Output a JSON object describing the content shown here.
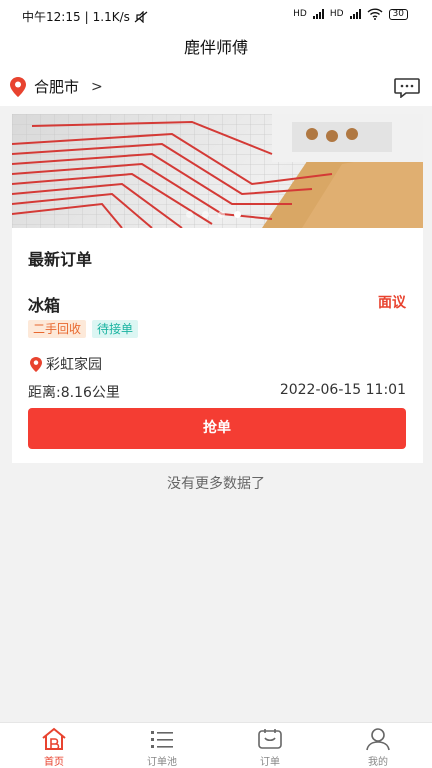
{
  "status": {
    "time": "中午12:15",
    "speed": "1.1K/s",
    "net1": "HD",
    "net2": "HD",
    "battery": "30"
  },
  "header": {
    "title": "鹿伴师傅"
  },
  "location": {
    "city": "合肥市"
  },
  "banner": {
    "total_slides": 4,
    "active_slide": 4
  },
  "latest": {
    "title": "最新订单",
    "order": {
      "name": "冰箱",
      "action": "面议",
      "tags": [
        "二手回收",
        "待接单"
      ],
      "address": "彩虹家园",
      "distance": "距离:8.16公里",
      "time": "2022-06-15 11:01",
      "button": "抢单"
    }
  },
  "no_more": "没有更多数据了",
  "tabs": [
    {
      "label": "首页",
      "icon": "home-icon",
      "active": true
    },
    {
      "label": "订单池",
      "icon": "list-icon",
      "active": false
    },
    {
      "label": "订单",
      "icon": "order-icon",
      "active": false
    },
    {
      "label": "我的",
      "icon": "user-icon",
      "active": false
    }
  ],
  "colors": {
    "accent": "#e8432f",
    "button": "#f43d33",
    "tag_orange": "#e8682f",
    "tag_cyan": "#1ab3a0"
  }
}
